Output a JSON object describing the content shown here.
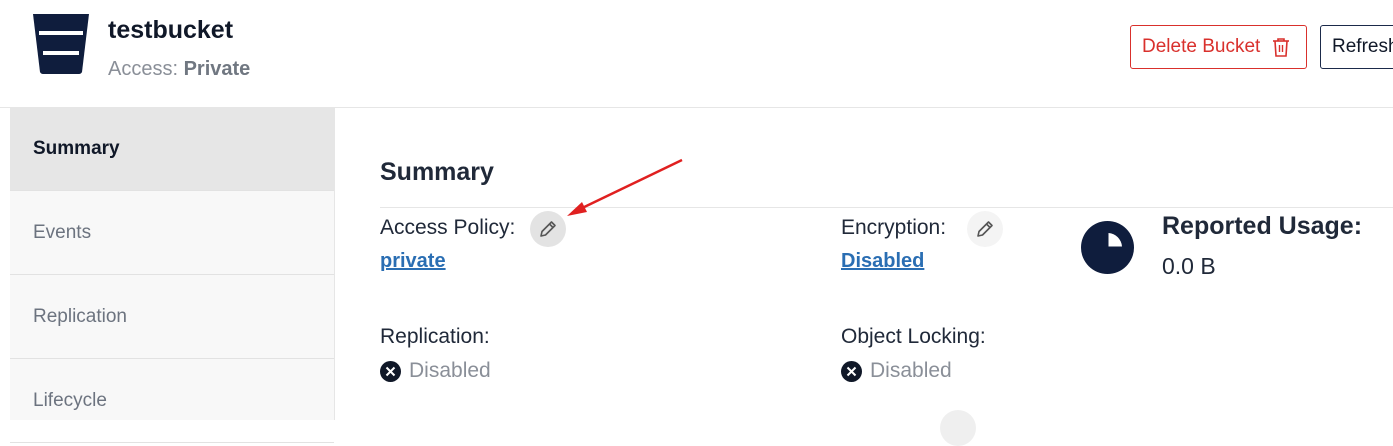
{
  "header": {
    "title": "testbucket",
    "access_label": "Access:",
    "access_value": "Private",
    "delete_label": "Delete Bucket",
    "refresh_label": "Refresh"
  },
  "sidebar": {
    "items": [
      {
        "label": "Summary",
        "active": true
      },
      {
        "label": "Events",
        "active": false
      },
      {
        "label": "Replication",
        "active": false
      },
      {
        "label": "Lifecycle",
        "active": false
      }
    ]
  },
  "summary": {
    "title": "Summary",
    "access_policy_label": "Access Policy:",
    "access_policy_value": "private",
    "encryption_label": "Encryption:",
    "encryption_value": "Disabled",
    "replication_label": "Replication:",
    "replication_value": "Disabled",
    "object_locking_label": "Object Locking:",
    "object_locking_value": "Disabled",
    "reported_usage_label": "Reported Usage:",
    "reported_usage_value": "0.0 B"
  },
  "colors": {
    "brand_navy": "#0f1d3d",
    "danger": "#d9302c",
    "link": "#2a6eb3",
    "annotation_arrow": "#e02020"
  },
  "icons": [
    "bucket-icon",
    "trash-icon",
    "pencil-icon",
    "close-circle-icon",
    "pie-chart-icon"
  ]
}
